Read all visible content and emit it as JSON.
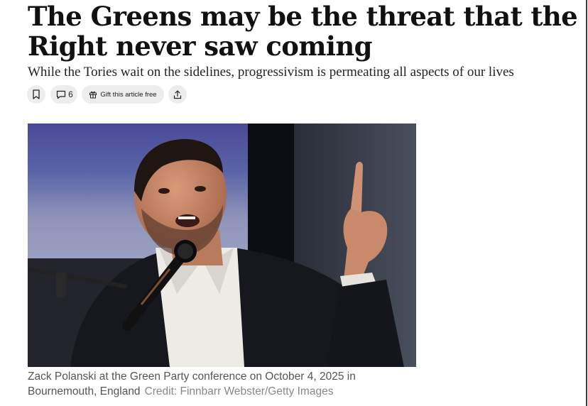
{
  "article": {
    "headline": "The Greens may be the threat that the Right never saw coming",
    "standfirst": "While the Tories wait on the sidelines, progressivism is permeating all aspects of our lives"
  },
  "toolbar": {
    "bookmark_icon": "bookmark-icon",
    "comments_icon": "comment-icon",
    "comments_count": "6",
    "gift_icon": "gift-icon",
    "gift_label": "Gift this article free",
    "share_icon": "share-icon"
  },
  "image": {
    "caption": "Zack Polanski at the Green Party conference on October 4, 2025 in Bournemouth, England",
    "credit": "Credit: Finnbarr Webster/Getty Images"
  }
}
